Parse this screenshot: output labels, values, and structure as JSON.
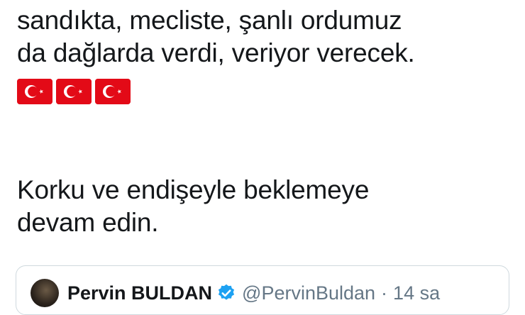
{
  "tweet": {
    "lines": [
      "sandıkta, mecliste, şanlı ordumuz",
      "da dağlarda verdi, veriyor verecek."
    ],
    "flags": [
      "turkey-flag",
      "turkey-flag",
      "turkey-flag"
    ],
    "second_paragraph": [
      "Korku ve endişeyle beklemeye",
      "devam edin."
    ]
  },
  "quoted_tweet": {
    "author_name": "Pervin BULDAN",
    "handle": "@PervinBuldan",
    "separator": "·",
    "time": "14 sa"
  },
  "colors": {
    "flag_red": "#e30a17",
    "verified_blue": "#1da1f2",
    "secondary_text": "#657786",
    "card_border": "#cfd9de"
  }
}
